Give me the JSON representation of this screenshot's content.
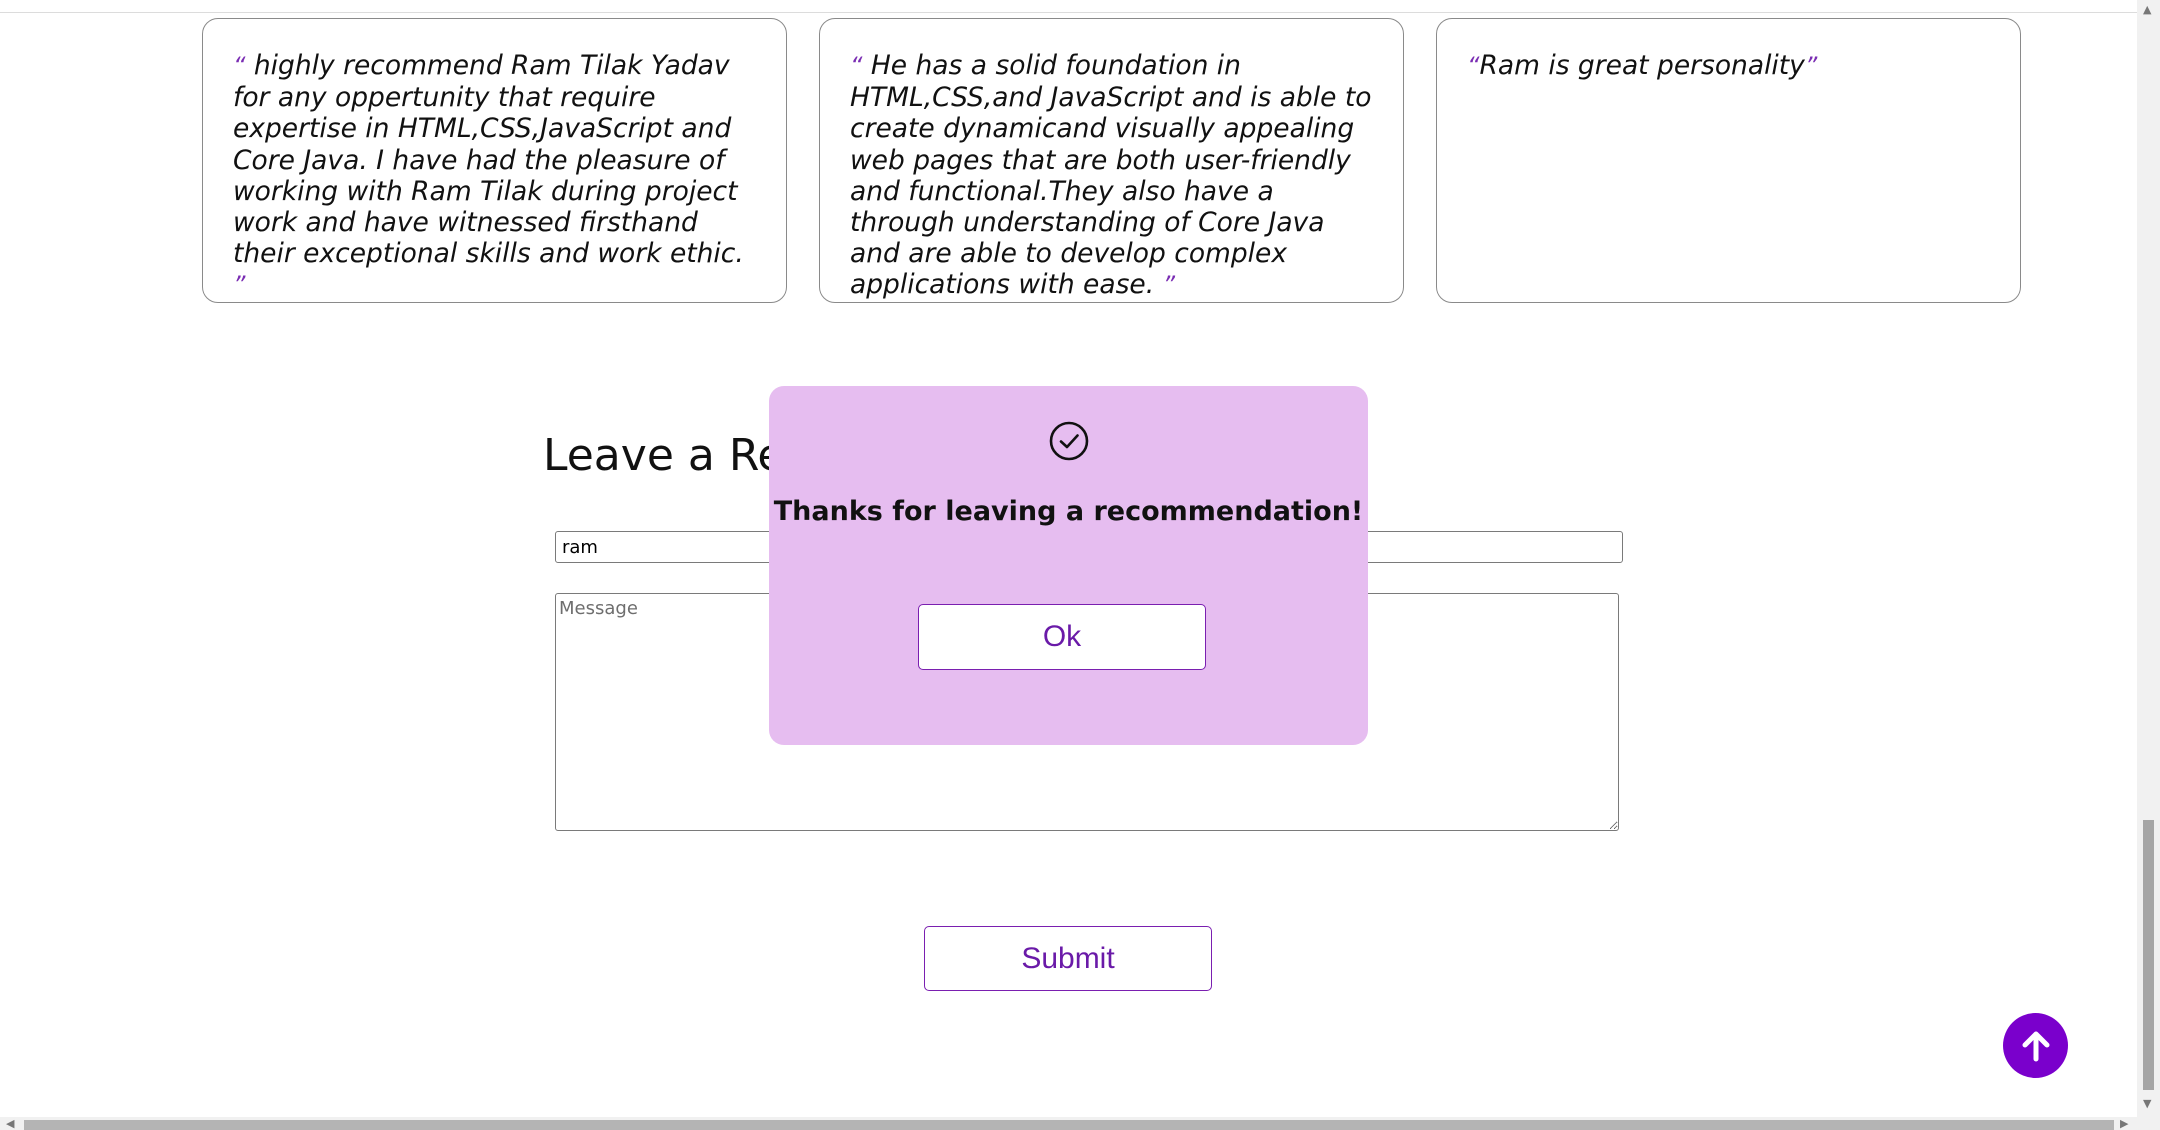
{
  "recommendations": [
    {
      "open_quote": "“",
      "text": " highly recommend Ram Tilak Yadav for any oppertunity that require expertise in HTML,CSS,JavaScript and Core Java. I have had the pleasure of working with Ram Tilak during project work and have witnessed firsthand their exceptional skills and work ethic. ",
      "close_quote": "”"
    },
    {
      "open_quote": "“",
      "text": " He has a solid foundation in HTML,CSS,and JavaScript and is able to create dynamicand visually appealing web pages that are both user-friendly and functional.They also have a through understanding of Core Java and are able to develop complex applications with ease. ",
      "close_quote": "”"
    },
    {
      "open_quote": "“",
      "text": "Ram is great personality",
      "close_quote": "”"
    }
  ],
  "form": {
    "title": "Leave a Recommendation",
    "name_value": "ram",
    "message_placeholder": "Message",
    "submit_label": "Submit"
  },
  "modal": {
    "icon": "check-circle-icon",
    "message": "Thanks for leaving a recommendation!",
    "ok_label": "Ok"
  },
  "back_to_top": {
    "icon": "arrow-up-icon"
  },
  "colors": {
    "accent": "#7a00cc",
    "modal_bg": "#e6bdf0"
  }
}
